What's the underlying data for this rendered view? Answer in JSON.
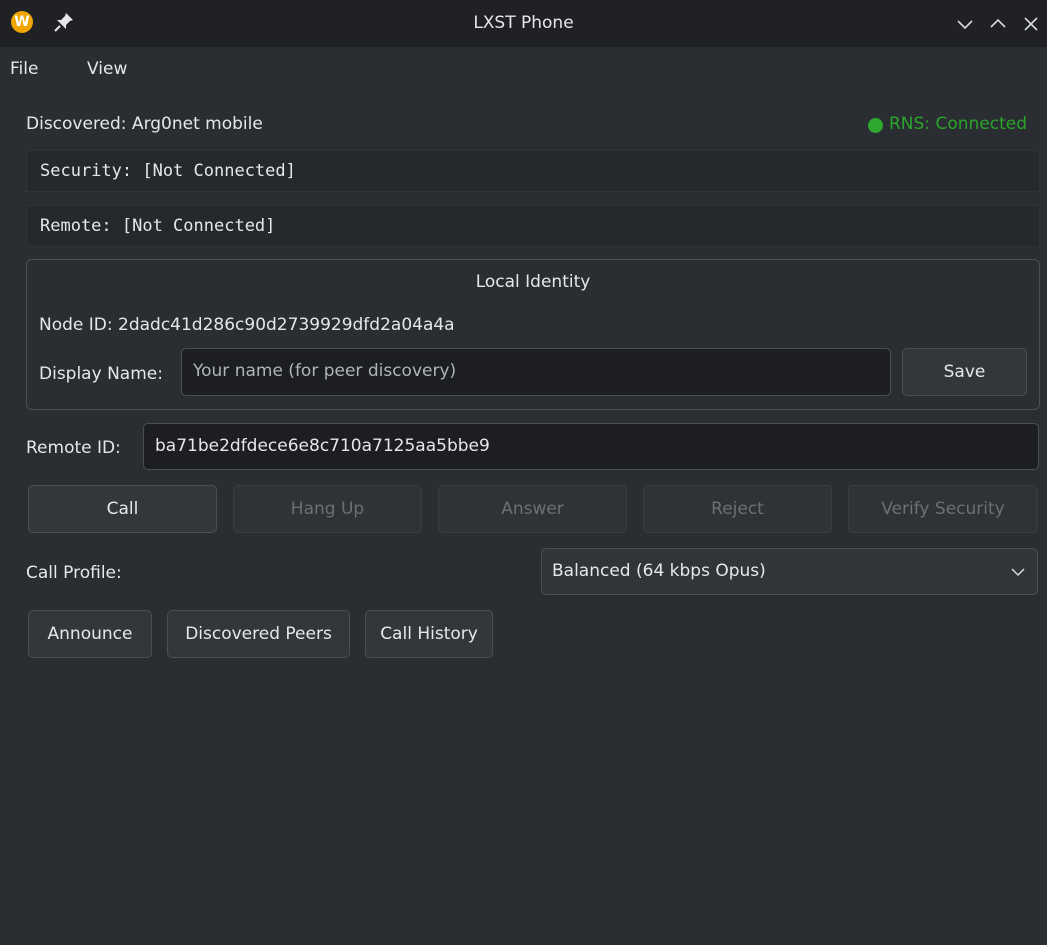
{
  "window": {
    "title": "LXST Phone",
    "app_icon_letter": "W",
    "icons": [
      "app-logo-icon",
      "pin-icon",
      "minimize-icon",
      "maximize-icon",
      "close-icon"
    ]
  },
  "menu": {
    "file": "File",
    "view": "View"
  },
  "status": {
    "discovered": "Discovered: Arg0net mobile",
    "rns": "RNS: Connected",
    "rns_color": "#2aa52a"
  },
  "security": "Security: [Not Connected]",
  "remote_status": "Remote: [Not Connected]",
  "local_identity": {
    "title": "Local Identity",
    "node_id": "Node ID: 2dadc41d286c90d2739929dfd2a04a4a",
    "display_name_label": "Display Name:",
    "display_name_placeholder": "Your name (for peer discovery)",
    "save_label": "Save"
  },
  "remote": {
    "label": "Remote ID:",
    "value": "ba71be2dfdece6e8c710a7125aa5bbe9"
  },
  "call_buttons": {
    "call": "Call",
    "hang_up": "Hang Up",
    "answer": "Answer",
    "reject": "Reject",
    "verify": "Verify Security"
  },
  "profile": {
    "label": "Call Profile:",
    "selected": "Balanced (64 kbps Opus)"
  },
  "actions": {
    "announce": "Announce",
    "discovered_peers": "Discovered Peers",
    "call_history": "Call History"
  }
}
